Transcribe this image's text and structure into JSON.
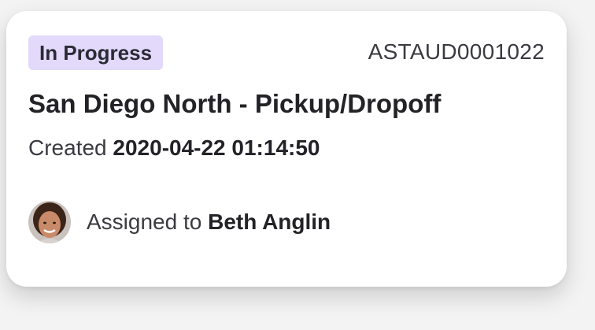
{
  "card": {
    "status_badge": "In Progress",
    "ticket_id": "ASTAUD0001022",
    "title": "San Diego North - Pickup/Dropoff",
    "created_prefix": "Created",
    "created_timestamp": "2020-04-22 01:14:50",
    "assigned_prefix": "Assigned to",
    "assignee_name": "Beth Anglin"
  },
  "colors": {
    "badge_bg": "#e3d9fb",
    "card_bg": "#ffffff",
    "page_bg": "#f3f3f4",
    "text_primary": "#222227"
  }
}
